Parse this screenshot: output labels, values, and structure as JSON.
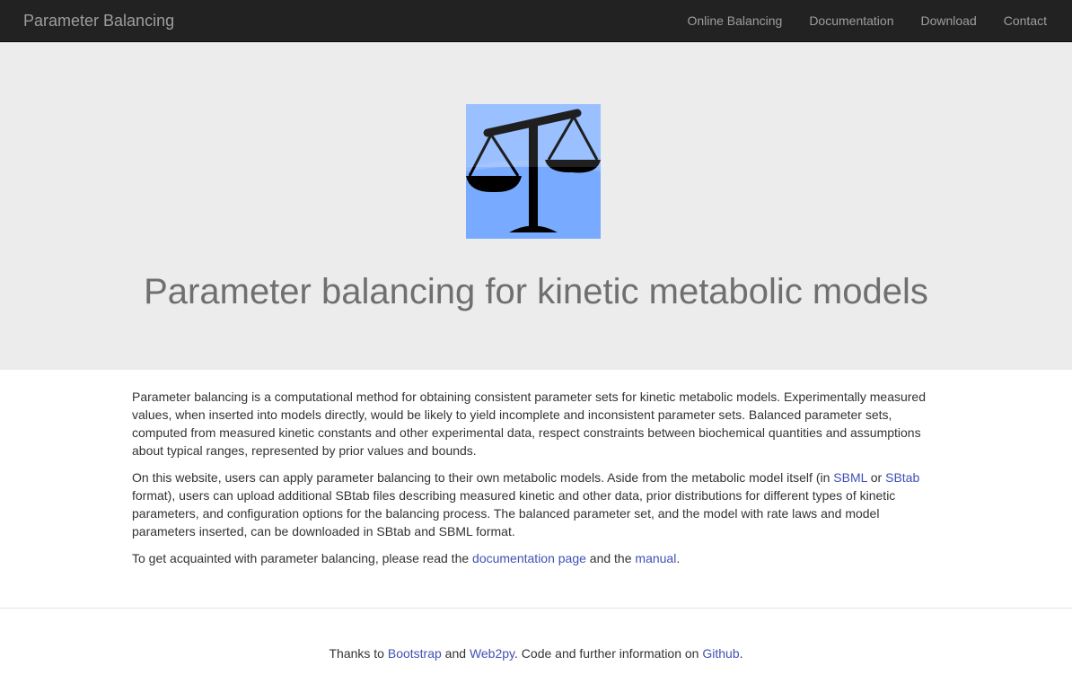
{
  "navbar": {
    "brand": "Parameter Balancing",
    "links": [
      "Online Balancing",
      "Documentation",
      "Download",
      "Contact"
    ]
  },
  "hero": {
    "title": "Parameter balancing for kinetic metabolic models",
    "logo_icon": "balance-scale-icon",
    "logo_colors": {
      "background": "#78aaff",
      "scale": "#000000"
    }
  },
  "content": {
    "p1": "Parameter balancing is a computational method for obtaining consistent parameter sets for kinetic metabolic models. Experimentally measured values, when inserted into models directly, would be likely to yield incomplete and inconsistent parameter sets. Balanced parameter sets, computed from measured kinetic constants and other experimental data, respect constraints between biochemical quantities and assumptions about typical ranges, represented by prior values and bounds.",
    "p2": {
      "text_a": "On this website, users can apply parameter balancing to their own metabolic models. Aside from the metabolic model itself (in ",
      "link_sbml": "SBML",
      "text_b": " or ",
      "link_sbtab": "SBtab",
      "text_c": " format), users can upload additional SBtab files describing measured kinetic and other data, prior distributions for different types of kinetic parameters, and configuration options for the balancing process. The balanced parameter set, and the model with rate laws and model parameters inserted, can be downloaded in SBtab and SBML format."
    },
    "p3": {
      "text_a": "To get acquainted with parameter balancing, please read the ",
      "link_docs": "documentation page",
      "text_b": " and the ",
      "link_manual": "manual",
      "text_c": "."
    }
  },
  "footer": {
    "text_a": "Thanks to ",
    "link_bootstrap": "Bootstrap",
    "text_b": " and ",
    "link_web2py": "Web2py",
    "text_c": ". Code and further information on ",
    "link_github": "Github",
    "text_d": "."
  },
  "colors": {
    "navbar": "#222222",
    "jumbotron": "#ececec",
    "link": "#3f51b5"
  }
}
